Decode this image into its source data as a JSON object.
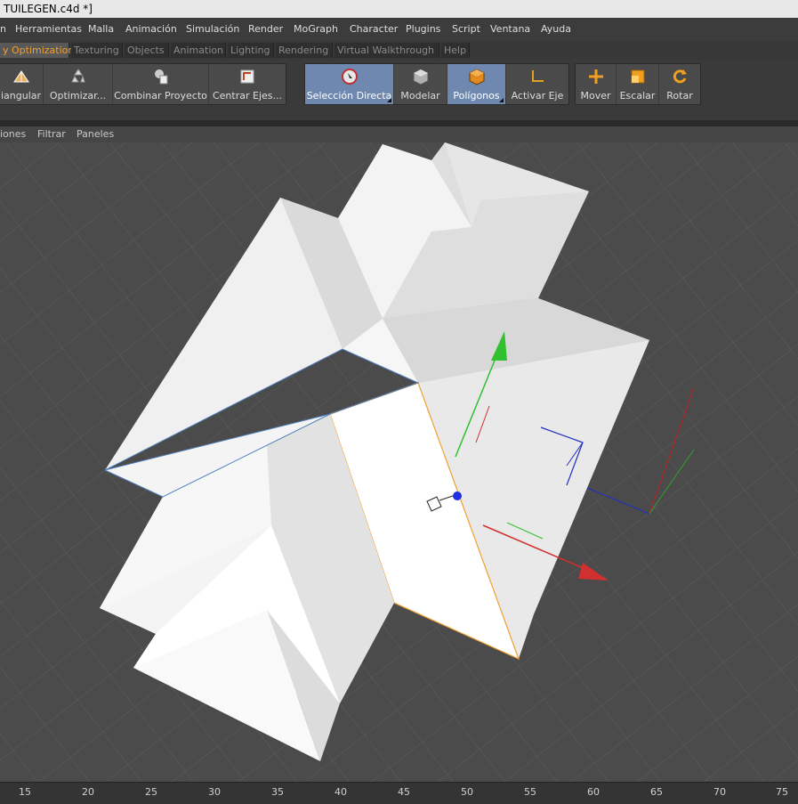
{
  "window": {
    "title": "TUILEGEN.c4d *]"
  },
  "menu": [
    "Herramientas",
    "Malla",
    "Animación",
    "Simulación",
    "Render",
    "MoGraph",
    "Character",
    "Plugins",
    "Script",
    "Ventana",
    "Ayuda"
  ],
  "tabs": [
    "y Optimization",
    "Texturing",
    "Objects",
    "Animation",
    "Lighting",
    "Rendering",
    "Virtual Walkthrough",
    "Help"
  ],
  "toolbar": {
    "group1": [
      "iangular",
      "Optimizar...",
      "Combinar Proyecto",
      "Centrar Ejes..."
    ],
    "group2": [
      "Selección Directa",
      "Modelar",
      "Polígonos",
      "Activar Eje"
    ],
    "group3": [
      "Mover",
      "Escalar",
      "Rotar"
    ]
  },
  "viewport_menu": [
    "iones",
    "Filtrar",
    "Paneles"
  ],
  "timeline_ruler": [
    "15",
    "20",
    "25",
    "30",
    "35",
    "40",
    "45",
    "50",
    "55",
    "60",
    "65",
    "70",
    "75"
  ]
}
